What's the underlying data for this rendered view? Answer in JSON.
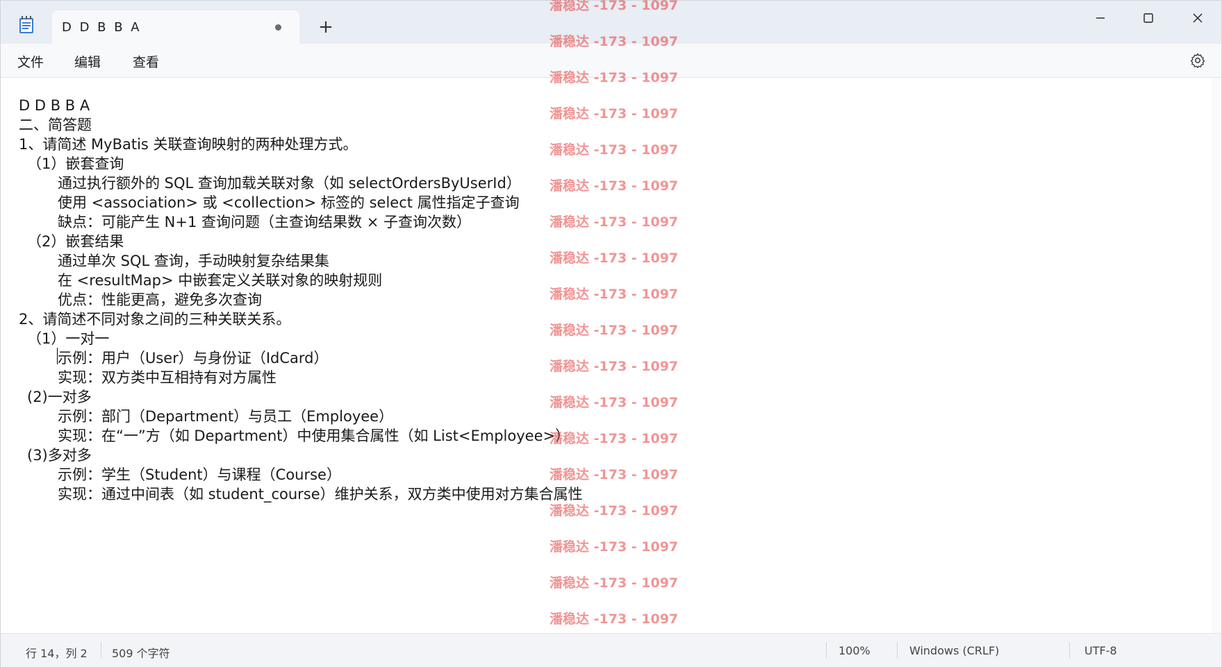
{
  "window": {
    "tab_title": "D D B B A",
    "new_tab_label": "+"
  },
  "menu": {
    "file": "文件",
    "edit": "编辑",
    "view": "查看"
  },
  "document": {
    "lines": [
      {
        "text": "D D B B A",
        "indent": 0
      },
      {
        "text": "二、简答题",
        "indent": 0
      },
      {
        "text": "1、请简述 MyBatis 关联查询映射的两种处理方式。",
        "indent": 0
      },
      {
        "text": "（1）嵌套查询",
        "indent": 1
      },
      {
        "text": "通过执行额外的 SQL 查询加载关联对象（如 selectOrdersByUserId）",
        "indent": 2
      },
      {
        "text": "使用 <association> 或 <collection> 标签的 select 属性指定子查询",
        "indent": 2
      },
      {
        "text": "缺点：可能产生 N+1 查询问题（主查询结果数 × 子查询次数）",
        "indent": 2
      },
      {
        "text": "（2）嵌套结果",
        "indent": 1
      },
      {
        "text": "通过单次 SQL 查询，手动映射复杂结果集",
        "indent": 2
      },
      {
        "text": "在 <resultMap> 中嵌套定义关联对象的映射规则",
        "indent": 2
      },
      {
        "text": "优点：性能更高，避免多次查询",
        "indent": 2
      },
      {
        "text": "2、请简述不同对象之间的三种关联关系。",
        "indent": 0
      },
      {
        "text": "（1）一对一",
        "indent": 1
      },
      {
        "text": "示例：用户（User）与身份证（IdCard）",
        "indent": 2
      },
      {
        "text": "实现：双方类中互相持有对方属性",
        "indent": 2
      },
      {
        "text": "(2)一对多",
        "indent": 1
      },
      {
        "text": "示例：部门（Department）与员工（Employee）",
        "indent": 2
      },
      {
        "text": "实现：在“一”方（如 Department）中使用集合属性（如 List<Employee>）",
        "indent": 2
      },
      {
        "text": "(3)多对多",
        "indent": 1
      },
      {
        "text": "示例：学生（Student）与课程（Course）",
        "indent": 2
      },
      {
        "text": "实现：通过中间表（如 student_course）维护关系，双方类中使用对方集合属性",
        "indent": 2
      }
    ]
  },
  "watermark": {
    "text": "潘稳达 -173 - 1097",
    "color": "#e83c3c"
  },
  "status": {
    "position": "行 14，列 2",
    "char_count": "509 个字符",
    "zoom": "100%",
    "line_ending": "Windows (CRLF)",
    "encoding": "UTF-8"
  },
  "icons": {
    "app": "notepad-icon",
    "settings": "gear-icon",
    "minimize": "minimize-icon",
    "maximize": "maximize-icon",
    "close": "close-icon"
  },
  "colors": {
    "titlebar": "#e9edf4",
    "tab_active": "#f8f9fb",
    "text": "#1a1a1a"
  }
}
